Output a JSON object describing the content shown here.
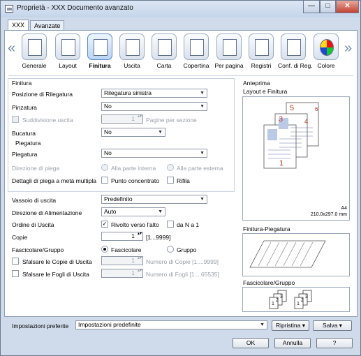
{
  "window": {
    "title": "Proprietà - XXX Documento avanzato",
    "min_symbol": "—",
    "max_symbol": "□",
    "close_symbol": "✕"
  },
  "tabs": [
    "XXX",
    "Avanzate"
  ],
  "ribbon": {
    "items": [
      {
        "label": "Generale",
        "icon": "general-icon"
      },
      {
        "label": "Layout",
        "icon": "layout-icon"
      },
      {
        "label": "Finitura",
        "icon": "finishing-icon",
        "selected": true
      },
      {
        "label": "Uscita",
        "icon": "output-icon"
      },
      {
        "label": "Carta",
        "icon": "paper-icon"
      },
      {
        "label": "Copertina",
        "icon": "cover-icon"
      },
      {
        "label": "Per pagina",
        "icon": "per-page-icon"
      },
      {
        "label": "Registri",
        "icon": "registers-icon"
      },
      {
        "label": "Conf. di Reg.",
        "icon": "register-config-icon"
      },
      {
        "label": "Colore",
        "icon": "color-icon"
      }
    ],
    "left_arrow": "«",
    "right_arrow": "»"
  },
  "finishing": {
    "section": "Finitura",
    "binding_label": "Posizione di Rilegatura",
    "binding_value": "Rilegatura sinistra",
    "staple_label": "Pinzatura",
    "staple_value": "No",
    "split_label": "Suddivisione uscita",
    "split_value": "1",
    "split_unit": "Pagine per sezione",
    "punch_label": "Bucatura",
    "punch_value": "No",
    "folding_section": "Piegatura",
    "fold_label": "Piegatura",
    "fold_value": "No",
    "fold_direction_label": "Direzione di piega",
    "fold_inside": "Alla parte interna",
    "fold_outside": "Alla parte esterna",
    "half_fold_label": "Dettagli di piega a metà multipla",
    "half_fold_option1": "Punto concentrato",
    "half_fold_option2": "Rifila"
  },
  "output": {
    "tray_label": "Vassoio di uscita",
    "tray_value": "Predefinito",
    "feed_label": "Direzione di Alimentazione",
    "feed_value": "Auto",
    "order_label": "Ordine di Uscita",
    "order_option1": "Rivolto verso l'alto",
    "order_option2": "da N a 1",
    "copies_label": "Copie",
    "copies_value": "1",
    "copies_range": "[1...9999]",
    "collate_label": "Fascicolare/Gruppo",
    "collate_option1": "Fascicolare",
    "collate_option2": "Gruppo",
    "offset_copies_label": "Sfalsare le Copie di Uscita",
    "offset_copies_value": "1",
    "offset_copies_unit": "Numero di Copie [1....9999]",
    "offset_sheets_label": "Sfalsare le Fogli di Uscita",
    "offset_sheets_value": "1",
    "offset_sheets_unit": "Numero di Fogli [1....65535]"
  },
  "preview": {
    "section": "Anteprima",
    "layout_title": "Layout e Finitura",
    "paper_size": "A4",
    "paper_dims": "210.0x297.0 mm",
    "page_numbers": [
      "5",
      "3",
      "1",
      "4",
      "6"
    ],
    "fold_title": "Finitura-Piegatura",
    "collate_title": "Fascicolare/Gruppo",
    "stack_numbers": [
      "1",
      "2",
      "3",
      "1",
      "2",
      "3"
    ]
  },
  "preferences": {
    "label": "Impostazioni preferite",
    "value": "Impostazioni predefinite",
    "restore": "Ripristina",
    "save": "Salva"
  },
  "buttons": {
    "ok": "OK",
    "cancel": "Annulla",
    "help": "?"
  }
}
